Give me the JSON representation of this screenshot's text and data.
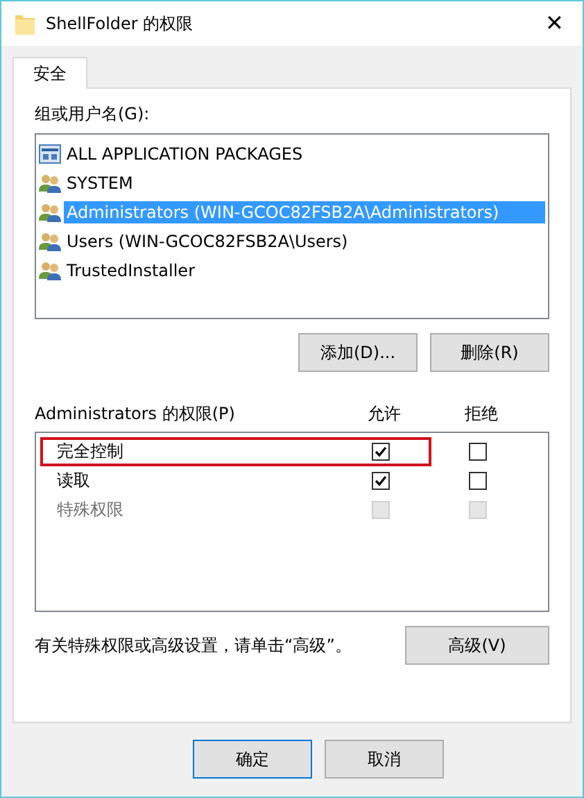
{
  "window": {
    "title": "ShellFolder 的权限",
    "close": "✕"
  },
  "tabs": [
    {
      "label": "安全",
      "selected": true
    }
  ],
  "groups": {
    "label": "组或用户名(G):",
    "items": [
      {
        "name": "ALL APPLICATION PACKAGES",
        "kind": "package",
        "selected": false
      },
      {
        "name": "SYSTEM",
        "kind": "users",
        "selected": false
      },
      {
        "name": "Administrators (WIN-GCOC82FSB2A\\Administrators)",
        "kind": "users",
        "selected": true
      },
      {
        "name": "Users (WIN-GCOC82FSB2A\\Users)",
        "kind": "users",
        "selected": false
      },
      {
        "name": "TrustedInstaller",
        "kind": "users",
        "selected": false
      }
    ],
    "buttons": [
      "添加(D)...",
      "删除(R)"
    ]
  },
  "permissions": {
    "label": "Administrators 的权限(P)",
    "allow_header": "允许",
    "deny_header": "拒绝",
    "rows": [
      {
        "name": "完全控制",
        "allow": true,
        "deny": false,
        "disabled": false,
        "highlighted": true
      },
      {
        "name": "读取",
        "allow": true,
        "deny": false,
        "disabled": false,
        "highlighted": false
      },
      {
        "name": "特殊权限",
        "allow": false,
        "deny": false,
        "disabled": true,
        "highlighted": false
      }
    ]
  },
  "advanced": {
    "note": "有关特殊权限或高级设置，请单击“高级”。",
    "button": "高级(V)"
  },
  "footer_buttons": [
    {
      "label": "确定",
      "default": true
    },
    {
      "label": "取消",
      "default": false
    }
  ]
}
